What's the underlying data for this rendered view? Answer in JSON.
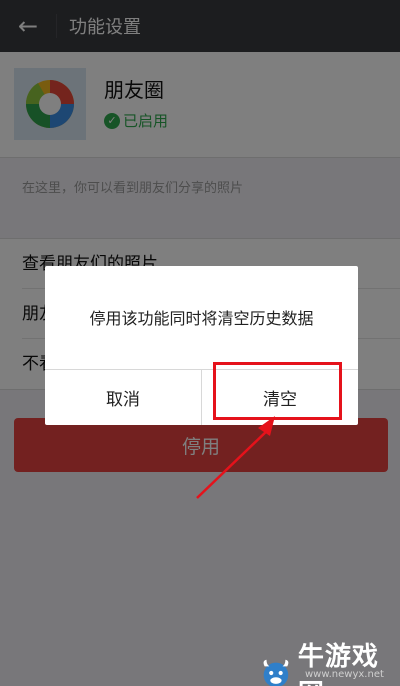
{
  "header": {
    "title": "功能设置",
    "back_icon": "arrow-left-icon"
  },
  "feature": {
    "name": "朋友圈",
    "status": "已启用",
    "icon": "camera-aperture-icon",
    "status_color": "#2fa94f"
  },
  "description": "在这里，你可以看到朋友们分享的照片",
  "settings_list": [
    {
      "label": "查看朋友们的照片"
    },
    {
      "label": "朋友"
    },
    {
      "label": "不看"
    }
  ],
  "disable_button": {
    "label": "停用",
    "color": "#e64340"
  },
  "dialog": {
    "message": "停用该功能同时将清空历史数据",
    "cancel_label": "取消",
    "confirm_label": "清空"
  },
  "annotation": {
    "highlight_color": "#e5121b"
  },
  "watermark": {
    "text": "牛游戏网",
    "url": "www.newyx.net"
  }
}
